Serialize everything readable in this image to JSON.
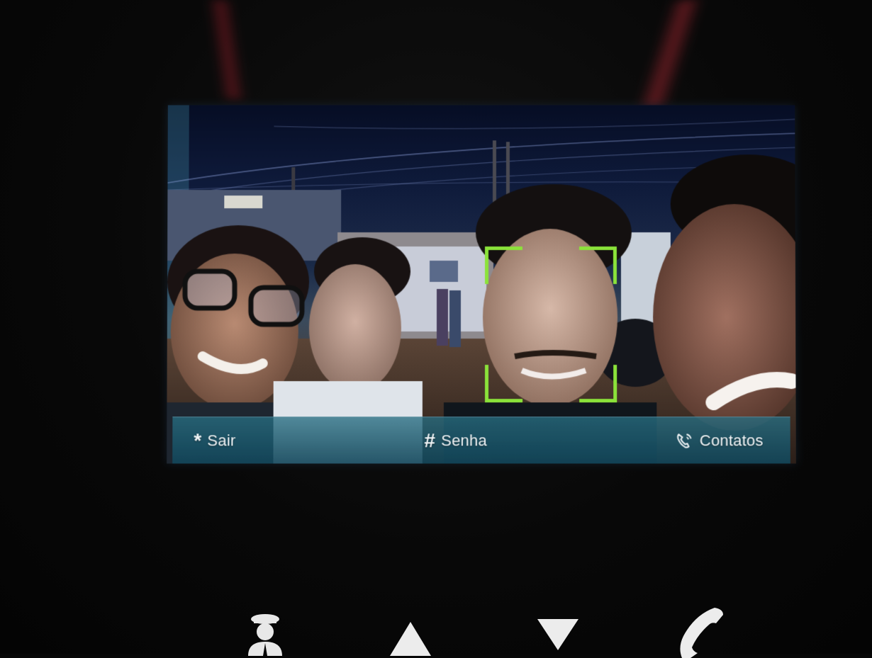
{
  "screen": {
    "mode": "facial-recognition-camera",
    "face_frame_color": "#8be33a",
    "bar_color": "#1f6a80"
  },
  "bottom_bar": {
    "exit": {
      "icon": "asterisk-icon",
      "symbol": "*",
      "label": "Sair"
    },
    "password": {
      "icon": "hash-icon",
      "symbol": "#",
      "label": "Senha"
    },
    "contacts": {
      "icon": "phone-contacts-icon",
      "label": "Contatos"
    }
  },
  "hardware_buttons": [
    {
      "icon": "doorman-icon"
    },
    {
      "icon": "arrow-up-icon"
    },
    {
      "icon": "arrow-down-icon"
    },
    {
      "icon": "phone-handset-icon"
    }
  ]
}
